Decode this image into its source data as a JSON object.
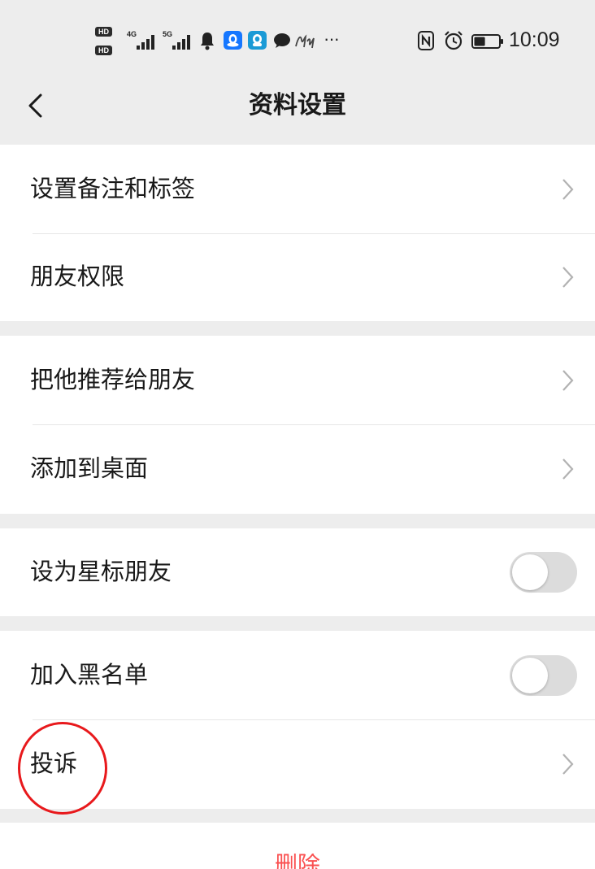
{
  "status_bar": {
    "hd_label_top": "HD",
    "hd_label_bottom": "HD",
    "signal_4g_label": "4G",
    "signal_5g_label": "5G",
    "more_label": "···",
    "time": "10:09",
    "battery_level": 0.45,
    "left_icons": [
      "hd-icon",
      "signal-4g-icon",
      "signal-5g-icon",
      "bell-icon",
      "qq-icon",
      "qq-icon",
      "chat-bubble-icon",
      "handwriting-icon"
    ],
    "right_icons": [
      "nfc-icon",
      "alarm-icon",
      "battery-icon"
    ]
  },
  "nav": {
    "back_icon": "chevron-left-icon",
    "title": "资料设置"
  },
  "sections": [
    {
      "items": [
        {
          "label": "设置备注和标签",
          "accessory_icon": "chevron-right-icon"
        },
        {
          "label": "朋友权限",
          "accessory_icon": "chevron-right-icon"
        }
      ]
    },
    {
      "items": [
        {
          "label": "把他推荐给朋友",
          "accessory_icon": "chevron-right-icon"
        },
        {
          "label": "添加到桌面",
          "accessory_icon": "chevron-right-icon"
        }
      ]
    },
    {
      "items": [
        {
          "label": "设为星标朋友",
          "toggle_on": false
        }
      ]
    },
    {
      "items": [
        {
          "label": "加入黑名单",
          "toggle_on": false
        },
        {
          "label": "投诉",
          "accessory_icon": "chevron-right-icon"
        }
      ]
    }
  ],
  "delete_button": {
    "label": "删除"
  },
  "colors": {
    "background": "#ededed",
    "row": "#ffffff",
    "text": "#191919",
    "status_text": "#222222",
    "chevron": "#b2b2b2",
    "divider": "#e6e6e6",
    "toggle_off": "#dcdcdc",
    "toggle_on": "#07c160",
    "delete_text": "#fa5151",
    "annotation_color": "#e8191c",
    "qq_blue": "#1677ff",
    "qq_teal": "#1a9ad6"
  }
}
